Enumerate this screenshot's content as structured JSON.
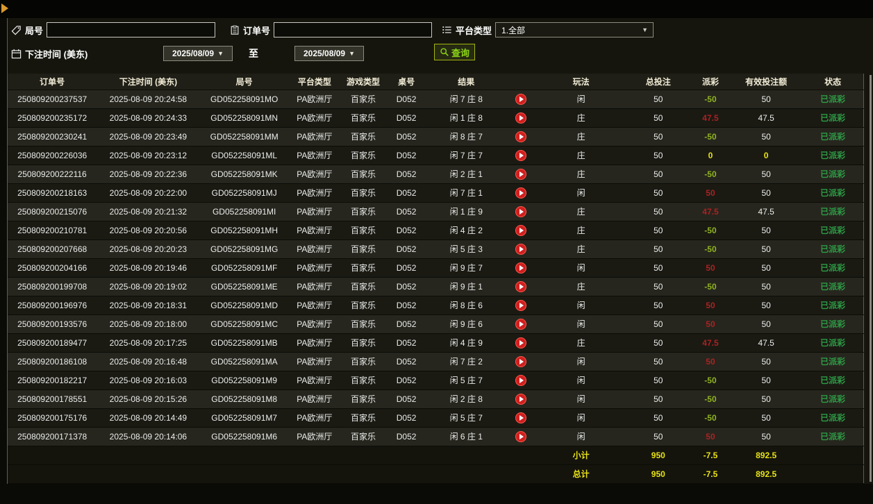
{
  "filters": {
    "round": {
      "label": "局号",
      "value": ""
    },
    "order": {
      "label": "订单号",
      "value": ""
    },
    "platform": {
      "label": "平台类型",
      "value": "1.全部"
    },
    "bet_time": {
      "label": "下注时间 (美东)"
    },
    "date_from": "2025/08/09",
    "date_to": "2025/08/09",
    "to_label": "至",
    "query_button": "查询"
  },
  "table": {
    "headers": [
      "订单号",
      "下注时间 (美东)",
      "局号",
      "平台类型",
      "游戏类型",
      "桌号",
      "结果",
      "",
      "玩法",
      "总投注",
      "派彩",
      "有效投注额",
      "状态"
    ],
    "rows": [
      {
        "order": "250809200237537",
        "time": "2025-08-09 20:24:58",
        "round": "GD052258091MO",
        "platform": "PA欧洲厅",
        "game": "百家乐",
        "table": "D052",
        "result": "闲 7 庄 8",
        "bet": "闲",
        "total": "50",
        "payout": "-50",
        "valid": "50",
        "status": "已派彩"
      },
      {
        "order": "250809200235172",
        "time": "2025-08-09 20:24:33",
        "round": "GD052258091MN",
        "platform": "PA欧洲厅",
        "game": "百家乐",
        "table": "D052",
        "result": "闲 1 庄 8",
        "bet": "庄",
        "total": "50",
        "payout": "47.5",
        "valid": "47.5",
        "status": "已派彩"
      },
      {
        "order": "250809200230241",
        "time": "2025-08-09 20:23:49",
        "round": "GD052258091MM",
        "platform": "PA欧洲厅",
        "game": "百家乐",
        "table": "D052",
        "result": "闲 8 庄 7",
        "bet": "庄",
        "total": "50",
        "payout": "-50",
        "valid": "50",
        "status": "已派彩"
      },
      {
        "order": "250809200226036",
        "time": "2025-08-09 20:23:12",
        "round": "GD052258091ML",
        "platform": "PA欧洲厅",
        "game": "百家乐",
        "table": "D052",
        "result": "闲 7 庄 7",
        "bet": "庄",
        "total": "50",
        "payout": "0",
        "valid": "0",
        "status": "已派彩"
      },
      {
        "order": "250809200222116",
        "time": "2025-08-09 20:22:36",
        "round": "GD052258091MK",
        "platform": "PA欧洲厅",
        "game": "百家乐",
        "table": "D052",
        "result": "闲 2 庄 1",
        "bet": "庄",
        "total": "50",
        "payout": "-50",
        "valid": "50",
        "status": "已派彩"
      },
      {
        "order": "250809200218163",
        "time": "2025-08-09 20:22:00",
        "round": "GD052258091MJ",
        "platform": "PA欧洲厅",
        "game": "百家乐",
        "table": "D052",
        "result": "闲 7 庄 1",
        "bet": "闲",
        "total": "50",
        "payout": "50",
        "valid": "50",
        "status": "已派彩"
      },
      {
        "order": "250809200215076",
        "time": "2025-08-09 20:21:32",
        "round": "GD052258091MI",
        "platform": "PA欧洲厅",
        "game": "百家乐",
        "table": "D052",
        "result": "闲 1 庄 9",
        "bet": "庄",
        "total": "50",
        "payout": "47.5",
        "valid": "47.5",
        "status": "已派彩"
      },
      {
        "order": "250809200210781",
        "time": "2025-08-09 20:20:56",
        "round": "GD052258091MH",
        "platform": "PA欧洲厅",
        "game": "百家乐",
        "table": "D052",
        "result": "闲 4 庄 2",
        "bet": "庄",
        "total": "50",
        "payout": "-50",
        "valid": "50",
        "status": "已派彩"
      },
      {
        "order": "250809200207668",
        "time": "2025-08-09 20:20:23",
        "round": "GD052258091MG",
        "platform": "PA欧洲厅",
        "game": "百家乐",
        "table": "D052",
        "result": "闲 5 庄 3",
        "bet": "庄",
        "total": "50",
        "payout": "-50",
        "valid": "50",
        "status": "已派彩"
      },
      {
        "order": "250809200204166",
        "time": "2025-08-09 20:19:46",
        "round": "GD052258091MF",
        "platform": "PA欧洲厅",
        "game": "百家乐",
        "table": "D052",
        "result": "闲 9 庄 7",
        "bet": "闲",
        "total": "50",
        "payout": "50",
        "valid": "50",
        "status": "已派彩"
      },
      {
        "order": "250809200199708",
        "time": "2025-08-09 20:19:02",
        "round": "GD052258091ME",
        "platform": "PA欧洲厅",
        "game": "百家乐",
        "table": "D052",
        "result": "闲 9 庄 1",
        "bet": "庄",
        "total": "50",
        "payout": "-50",
        "valid": "50",
        "status": "已派彩"
      },
      {
        "order": "250809200196976",
        "time": "2025-08-09 20:18:31",
        "round": "GD052258091MD",
        "platform": "PA欧洲厅",
        "game": "百家乐",
        "table": "D052",
        "result": "闲 8 庄 6",
        "bet": "闲",
        "total": "50",
        "payout": "50",
        "valid": "50",
        "status": "已派彩"
      },
      {
        "order": "250809200193576",
        "time": "2025-08-09 20:18:00",
        "round": "GD052258091MC",
        "platform": "PA欧洲厅",
        "game": "百家乐",
        "table": "D052",
        "result": "闲 9 庄 6",
        "bet": "闲",
        "total": "50",
        "payout": "50",
        "valid": "50",
        "status": "已派彩"
      },
      {
        "order": "250809200189477",
        "time": "2025-08-09 20:17:25",
        "round": "GD052258091MB",
        "platform": "PA欧洲厅",
        "game": "百家乐",
        "table": "D052",
        "result": "闲 4 庄 9",
        "bet": "庄",
        "total": "50",
        "payout": "47.5",
        "valid": "47.5",
        "status": "已派彩"
      },
      {
        "order": "250809200186108",
        "time": "2025-08-09 20:16:48",
        "round": "GD052258091MA",
        "platform": "PA欧洲厅",
        "game": "百家乐",
        "table": "D052",
        "result": "闲 7 庄 2",
        "bet": "闲",
        "total": "50",
        "payout": "50",
        "valid": "50",
        "status": "已派彩"
      },
      {
        "order": "250809200182217",
        "time": "2025-08-09 20:16:03",
        "round": "GD052258091M9",
        "platform": "PA欧洲厅",
        "game": "百家乐",
        "table": "D052",
        "result": "闲 5 庄 7",
        "bet": "闲",
        "total": "50",
        "payout": "-50",
        "valid": "50",
        "status": "已派彩"
      },
      {
        "order": "250809200178551",
        "time": "2025-08-09 20:15:26",
        "round": "GD052258091M8",
        "platform": "PA欧洲厅",
        "game": "百家乐",
        "table": "D052",
        "result": "闲 2 庄 8",
        "bet": "闲",
        "total": "50",
        "payout": "-50",
        "valid": "50",
        "status": "已派彩"
      },
      {
        "order": "250809200175176",
        "time": "2025-08-09 20:14:49",
        "round": "GD052258091M7",
        "platform": "PA欧洲厅",
        "game": "百家乐",
        "table": "D052",
        "result": "闲 5 庄 7",
        "bet": "闲",
        "total": "50",
        "payout": "-50",
        "valid": "50",
        "status": "已派彩"
      },
      {
        "order": "250809200171378",
        "time": "2025-08-09 20:14:06",
        "round": "GD052258091M6",
        "platform": "PA欧洲厅",
        "game": "百家乐",
        "table": "D052",
        "result": "闲 6 庄 1",
        "bet": "闲",
        "total": "50",
        "payout": "50",
        "valid": "50",
        "status": "已派彩"
      }
    ],
    "subtotal": {
      "label": "小计",
      "total_bet": "950",
      "payout": "-7.5",
      "valid_bet": "892.5"
    },
    "total": {
      "label": "总计",
      "total_bet": "950",
      "payout": "-7.5",
      "valid_bet": "892.5"
    }
  },
  "colors": {
    "win": "#aa2222",
    "loss": "#8fb222",
    "zero": "#e8e216",
    "status_paid": "#2e9c45",
    "summary": "#e8e216"
  }
}
